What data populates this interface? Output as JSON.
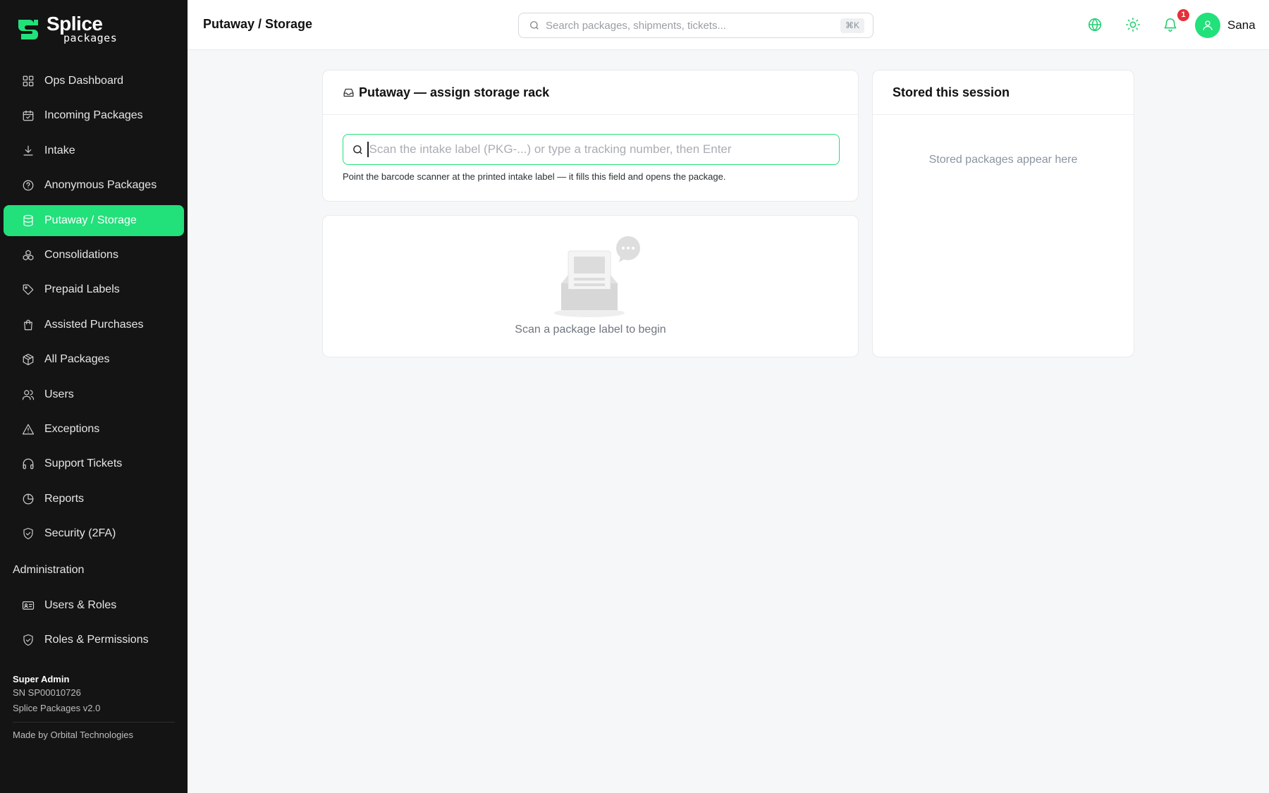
{
  "brand": {
    "name": "Splice",
    "sub": "packages",
    "accent": "#22e07a"
  },
  "sidebar": {
    "items": [
      {
        "label": "Ops Dashboard",
        "icon": "grid-icon"
      },
      {
        "label": "Incoming Packages",
        "icon": "calendar-icon"
      },
      {
        "label": "Intake",
        "icon": "download-icon"
      },
      {
        "label": "Anonymous Packages",
        "icon": "help-circle-icon"
      },
      {
        "label": "Putaway / Storage",
        "icon": "database-icon",
        "active": true
      },
      {
        "label": "Consolidations",
        "icon": "boxes-icon"
      },
      {
        "label": "Prepaid Labels",
        "icon": "tag-icon"
      },
      {
        "label": "Assisted Purchases",
        "icon": "shopping-bag-icon"
      },
      {
        "label": "All Packages",
        "icon": "package-icon"
      },
      {
        "label": "Users",
        "icon": "users-icon"
      },
      {
        "label": "Exceptions",
        "icon": "alert-triangle-icon"
      },
      {
        "label": "Support Tickets",
        "icon": "headphones-icon"
      },
      {
        "label": "Reports",
        "icon": "pie-chart-icon"
      },
      {
        "label": "Security (2FA)",
        "icon": "shield-check-icon"
      }
    ],
    "admin_title": "Administration",
    "admin_items": [
      {
        "label": "Users & Roles",
        "icon": "id-card-icon"
      },
      {
        "label": "Roles & Permissions",
        "icon": "shield-check-icon"
      }
    ],
    "footer": {
      "role": "Super Admin",
      "serial": "SN SP00010726",
      "version": "Splice Packages v2.0",
      "credit": "Made by Orbital Technologies"
    }
  },
  "topbar": {
    "title": "Putaway / Storage",
    "search_placeholder": "Search packages, shipments, tickets...",
    "search_shortcut": "⌘K",
    "notification_count": "1",
    "user_name": "Sana"
  },
  "putaway": {
    "title": "Putaway — assign storage rack",
    "input_placeholder": "Scan the intake label (PKG-...) or type a tracking number, then Enter",
    "hint": "Point the barcode scanner at the printed intake label — it fills this field and opens the package."
  },
  "empty_state": {
    "text": "Scan a package label to begin"
  },
  "session": {
    "title": "Stored this session",
    "empty_text": "Stored packages appear here"
  }
}
